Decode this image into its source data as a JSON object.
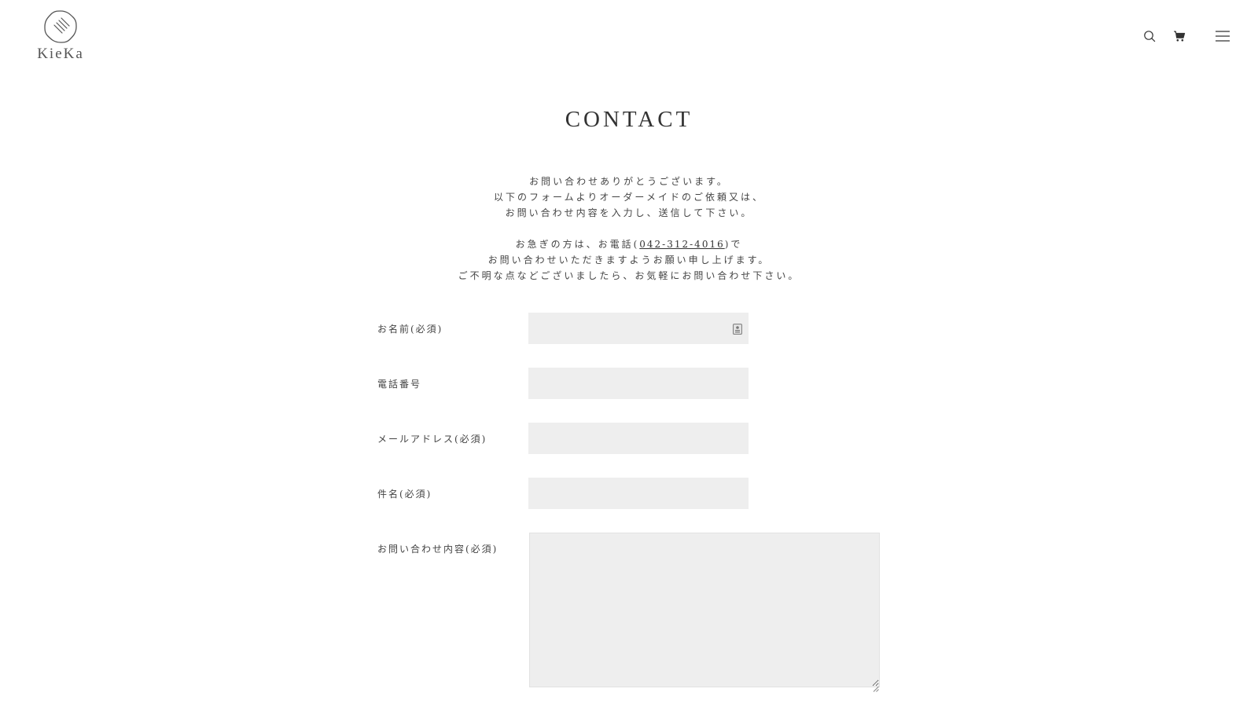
{
  "header": {
    "logo_text": "KieKa",
    "icons": {
      "search": "search-icon",
      "cart": "cart-icon",
      "menu": "hamburger-menu-icon"
    }
  },
  "main": {
    "title": "CONTACT",
    "intro": {
      "line1": "お問い合わせありがとうございます。",
      "line2": "以下のフォームよりオーダーメイドのご依頼又は、",
      "line3": "お問い合わせ内容を入力し、送信して下さい。",
      "line4_prefix": "お急ぎの方は、お電話(",
      "phone": "042-312-4016",
      "line4_suffix": ")で",
      "line5": "お問い合わせいただきますようお願い申し上げます。",
      "line6": "ご不明な点などございましたら、お気軽にお問い合わせ下さい。"
    }
  },
  "form": {
    "name_label": "お名前(必須)",
    "name_value": "",
    "phone_label": "電話番号",
    "phone_value": "",
    "email_label": "メールアドレス(必須)",
    "email_value": "",
    "subject_label": "件名(必須)",
    "subject_value": "",
    "message_label": "お問い合わせ内容(必須)",
    "message_value": ""
  },
  "colors": {
    "background": "#ffffff",
    "text": "#333333",
    "input_background": "#eeeeee"
  }
}
